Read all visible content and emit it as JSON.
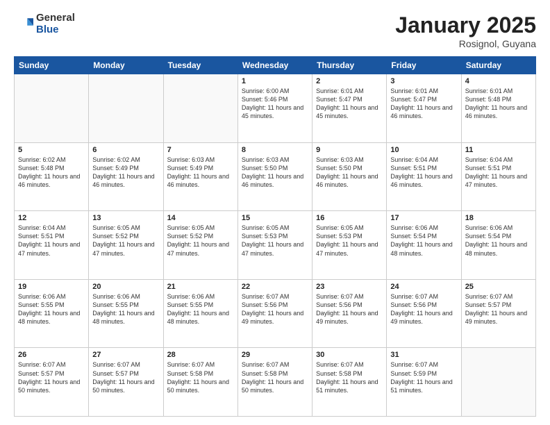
{
  "header": {
    "logo": {
      "general": "General",
      "blue": "Blue"
    },
    "title": "January 2025",
    "location": "Rosignol, Guyana"
  },
  "weekdays": [
    "Sunday",
    "Monday",
    "Tuesday",
    "Wednesday",
    "Thursday",
    "Friday",
    "Saturday"
  ],
  "weeks": [
    [
      {
        "day": "",
        "info": ""
      },
      {
        "day": "",
        "info": ""
      },
      {
        "day": "",
        "info": ""
      },
      {
        "day": "1",
        "info": "Sunrise: 6:00 AM\nSunset: 5:46 PM\nDaylight: 11 hours and 45 minutes."
      },
      {
        "day": "2",
        "info": "Sunrise: 6:01 AM\nSunset: 5:47 PM\nDaylight: 11 hours and 45 minutes."
      },
      {
        "day": "3",
        "info": "Sunrise: 6:01 AM\nSunset: 5:47 PM\nDaylight: 11 hours and 46 minutes."
      },
      {
        "day": "4",
        "info": "Sunrise: 6:01 AM\nSunset: 5:48 PM\nDaylight: 11 hours and 46 minutes."
      }
    ],
    [
      {
        "day": "5",
        "info": "Sunrise: 6:02 AM\nSunset: 5:48 PM\nDaylight: 11 hours and 46 minutes."
      },
      {
        "day": "6",
        "info": "Sunrise: 6:02 AM\nSunset: 5:49 PM\nDaylight: 11 hours and 46 minutes."
      },
      {
        "day": "7",
        "info": "Sunrise: 6:03 AM\nSunset: 5:49 PM\nDaylight: 11 hours and 46 minutes."
      },
      {
        "day": "8",
        "info": "Sunrise: 6:03 AM\nSunset: 5:50 PM\nDaylight: 11 hours and 46 minutes."
      },
      {
        "day": "9",
        "info": "Sunrise: 6:03 AM\nSunset: 5:50 PM\nDaylight: 11 hours and 46 minutes."
      },
      {
        "day": "10",
        "info": "Sunrise: 6:04 AM\nSunset: 5:51 PM\nDaylight: 11 hours and 46 minutes."
      },
      {
        "day": "11",
        "info": "Sunrise: 6:04 AM\nSunset: 5:51 PM\nDaylight: 11 hours and 47 minutes."
      }
    ],
    [
      {
        "day": "12",
        "info": "Sunrise: 6:04 AM\nSunset: 5:51 PM\nDaylight: 11 hours and 47 minutes."
      },
      {
        "day": "13",
        "info": "Sunrise: 6:05 AM\nSunset: 5:52 PM\nDaylight: 11 hours and 47 minutes."
      },
      {
        "day": "14",
        "info": "Sunrise: 6:05 AM\nSunset: 5:52 PM\nDaylight: 11 hours and 47 minutes."
      },
      {
        "day": "15",
        "info": "Sunrise: 6:05 AM\nSunset: 5:53 PM\nDaylight: 11 hours and 47 minutes."
      },
      {
        "day": "16",
        "info": "Sunrise: 6:05 AM\nSunset: 5:53 PM\nDaylight: 11 hours and 47 minutes."
      },
      {
        "day": "17",
        "info": "Sunrise: 6:06 AM\nSunset: 5:54 PM\nDaylight: 11 hours and 48 minutes."
      },
      {
        "day": "18",
        "info": "Sunrise: 6:06 AM\nSunset: 5:54 PM\nDaylight: 11 hours and 48 minutes."
      }
    ],
    [
      {
        "day": "19",
        "info": "Sunrise: 6:06 AM\nSunset: 5:55 PM\nDaylight: 11 hours and 48 minutes."
      },
      {
        "day": "20",
        "info": "Sunrise: 6:06 AM\nSunset: 5:55 PM\nDaylight: 11 hours and 48 minutes."
      },
      {
        "day": "21",
        "info": "Sunrise: 6:06 AM\nSunset: 5:55 PM\nDaylight: 11 hours and 48 minutes."
      },
      {
        "day": "22",
        "info": "Sunrise: 6:07 AM\nSunset: 5:56 PM\nDaylight: 11 hours and 49 minutes."
      },
      {
        "day": "23",
        "info": "Sunrise: 6:07 AM\nSunset: 5:56 PM\nDaylight: 11 hours and 49 minutes."
      },
      {
        "day": "24",
        "info": "Sunrise: 6:07 AM\nSunset: 5:56 PM\nDaylight: 11 hours and 49 minutes."
      },
      {
        "day": "25",
        "info": "Sunrise: 6:07 AM\nSunset: 5:57 PM\nDaylight: 11 hours and 49 minutes."
      }
    ],
    [
      {
        "day": "26",
        "info": "Sunrise: 6:07 AM\nSunset: 5:57 PM\nDaylight: 11 hours and 50 minutes."
      },
      {
        "day": "27",
        "info": "Sunrise: 6:07 AM\nSunset: 5:57 PM\nDaylight: 11 hours and 50 minutes."
      },
      {
        "day": "28",
        "info": "Sunrise: 6:07 AM\nSunset: 5:58 PM\nDaylight: 11 hours and 50 minutes."
      },
      {
        "day": "29",
        "info": "Sunrise: 6:07 AM\nSunset: 5:58 PM\nDaylight: 11 hours and 50 minutes."
      },
      {
        "day": "30",
        "info": "Sunrise: 6:07 AM\nSunset: 5:58 PM\nDaylight: 11 hours and 51 minutes."
      },
      {
        "day": "31",
        "info": "Sunrise: 6:07 AM\nSunset: 5:59 PM\nDaylight: 11 hours and 51 minutes."
      },
      {
        "day": "",
        "info": ""
      }
    ]
  ]
}
